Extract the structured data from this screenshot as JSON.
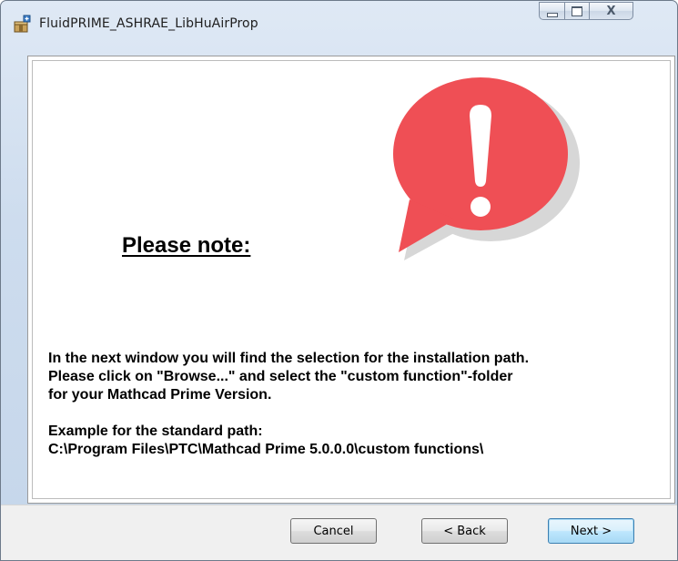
{
  "window": {
    "title": "FluidPRIME_ASHRAE_LibHuAirProp",
    "app_icon": "installer-package-icon",
    "caption_buttons": {
      "minimize_icon": "minimize-icon",
      "maximize_icon": "maximize-icon",
      "close_label": "X"
    }
  },
  "content": {
    "icon": "exclamation-speech-bubble-icon",
    "heading": "Please note:",
    "paragraph_lines": [
      "In the next window you will find the selection for the installation path.",
      "Please click on \"Browse...\" and select the \"custom function\"-folder",
      "for your Mathcad Prime Version."
    ],
    "example_label": "Example for the standard path:",
    "example_path": "C:\\Program Files\\PTC\\Mathcad Prime 5.0.0.0\\custom functions\\"
  },
  "buttons": {
    "cancel": "Cancel",
    "back": "< Back",
    "next": "Next >"
  },
  "colors": {
    "alert_red": "#ef4f55",
    "default_button_border": "#3c7fb1"
  }
}
